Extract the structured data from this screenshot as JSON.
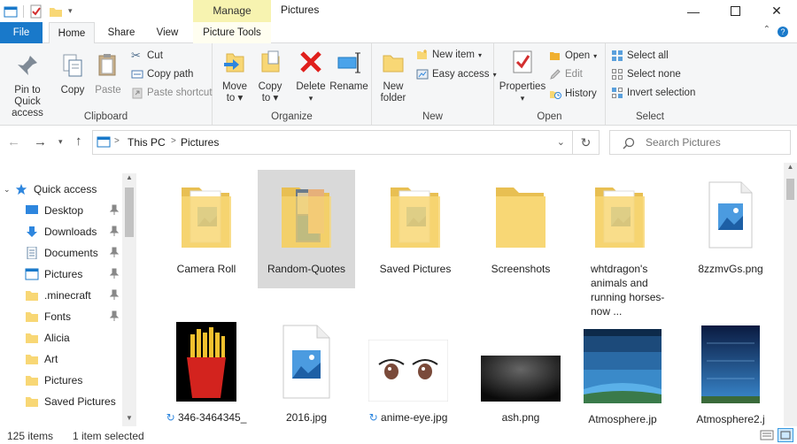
{
  "window": {
    "title": "Pictures",
    "manage": "Manage"
  },
  "tabs": {
    "file": "File",
    "home": "Home",
    "share": "Share",
    "view": "View",
    "picture_tools": "Picture Tools"
  },
  "ribbon": {
    "clipboard": {
      "label": "Clipboard",
      "pin": "Pin to Quick access",
      "pin1": "Pin to Quick",
      "pin2": "access",
      "copy": "Copy",
      "paste": "Paste",
      "cut": "Cut",
      "copy_path": "Copy path",
      "paste_shortcut": "Paste shortcut"
    },
    "organize": {
      "label": "Organize",
      "move_to": "Move",
      "move_to2": "to",
      "copy_to": "Copy",
      "copy_to2": "to",
      "delete": "Delete",
      "rename": "Rename"
    },
    "new": {
      "label": "New",
      "new_folder1": "New",
      "new_folder2": "folder",
      "new_item": "New item",
      "easy_access": "Easy access"
    },
    "open": {
      "label": "Open",
      "properties": "Properties",
      "open": "Open",
      "edit": "Edit",
      "history": "History"
    },
    "select": {
      "label": "Select",
      "select_all": "Select all",
      "select_none": "Select none",
      "invert": "Invert selection"
    }
  },
  "address": {
    "crumbs": [
      "This PC",
      "Pictures"
    ],
    "search_placeholder": "Search Pictures"
  },
  "nav": {
    "quick_access": "Quick access",
    "items": [
      {
        "label": "Desktop",
        "pinned": true
      },
      {
        "label": "Downloads",
        "pinned": true
      },
      {
        "label": "Documents",
        "pinned": true
      },
      {
        "label": "Pictures",
        "pinned": true
      },
      {
        "label": ".minecraft",
        "pinned": true
      },
      {
        "label": "Fonts",
        "pinned": true
      },
      {
        "label": "Alicia",
        "pinned": false
      },
      {
        "label": "Art",
        "pinned": false
      },
      {
        "label": "Pictures",
        "pinned": false
      },
      {
        "label": "Saved Pictures",
        "pinned": false
      }
    ]
  },
  "files": {
    "row1": [
      {
        "name": "Camera Roll",
        "kind": "folder-img"
      },
      {
        "name": "Random-Quotes",
        "kind": "folder-photo"
      },
      {
        "name": "Saved Pictures",
        "kind": "folder-img"
      },
      {
        "name": "Screenshots",
        "kind": "folder"
      },
      {
        "name": "whtdragon's animals and running horses- now ...",
        "kind": "folder-img"
      },
      {
        "name": "8zzmvGs.png",
        "kind": "image-file"
      }
    ],
    "row2": [
      {
        "name": "346-3464345_",
        "kind": "fries",
        "sync": true
      },
      {
        "name": "2016.jpg",
        "kind": "image-file",
        "sync": false
      },
      {
        "name": "anime-eye.jpg",
        "kind": "eyes",
        "sync": true
      },
      {
        "name": "ash.png",
        "kind": "ash",
        "sync": false
      },
      {
        "name": "Atmosphere.jp",
        "kind": "atmos",
        "sync": false
      },
      {
        "name": "Atmosphere2.j",
        "kind": "atmos2",
        "sync": false
      }
    ]
  },
  "status": {
    "count": "125 items",
    "selected": "1 item selected"
  },
  "colors": {
    "accent": "#1979ca",
    "folder": "#f8d775",
    "selection": "#d9d9d9"
  }
}
